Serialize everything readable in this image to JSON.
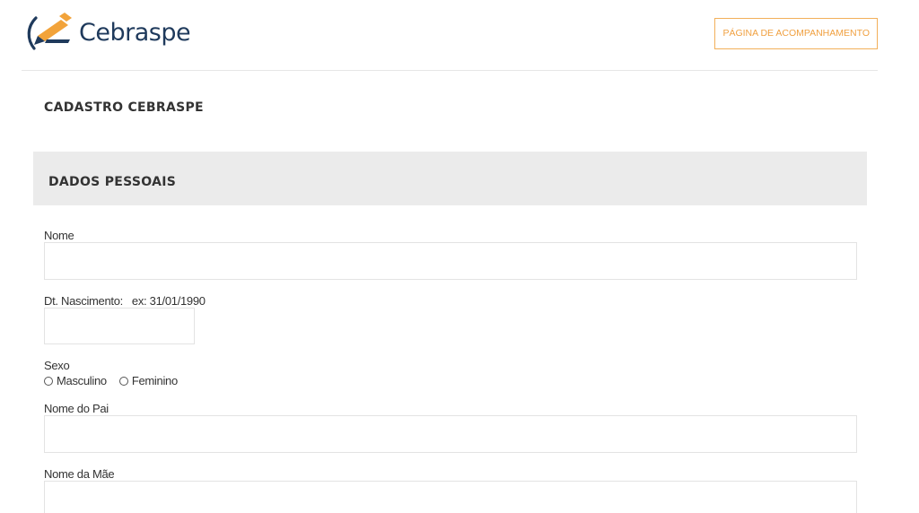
{
  "header": {
    "logo_text": "Cebraspe",
    "track_button": "PÁGINA DE ACOMPANHAMENTO"
  },
  "page_title": "CADASTRO CEBRASPE",
  "section": {
    "title": "DADOS PESSOAIS"
  },
  "form": {
    "nome": {
      "label": "Nome",
      "value": ""
    },
    "nascimento": {
      "label": "Dt. Nascimento:   ex: 31/01/1990",
      "value": ""
    },
    "sexo": {
      "label": "Sexo",
      "options": [
        "Masculino",
        "Feminino"
      ],
      "selected": null
    },
    "pai": {
      "label": "Nome do Pai",
      "value": ""
    },
    "mae": {
      "label": "Nome da Mãe",
      "value": ""
    }
  },
  "colors": {
    "accent_orange": "#f0a040",
    "logo_blue": "#1f3a5c",
    "section_bg": "#ebebeb"
  }
}
